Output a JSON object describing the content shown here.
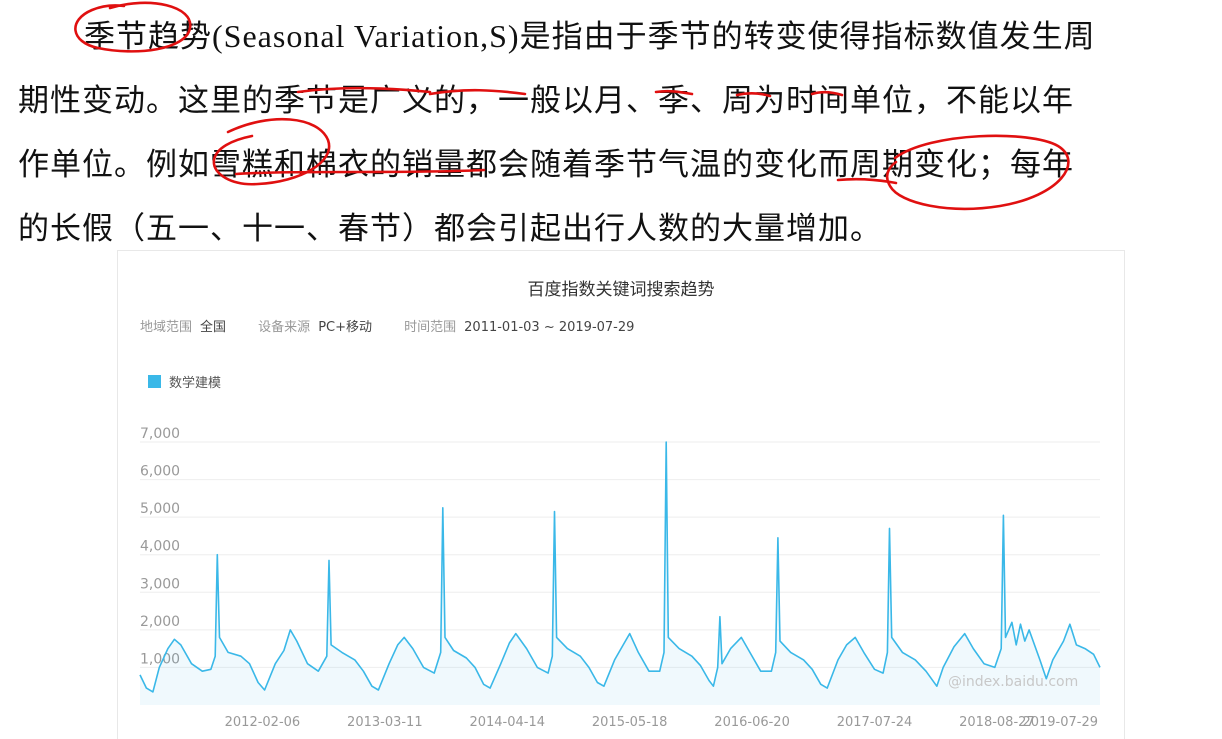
{
  "paragraph": {
    "lines": [
      [
        "季节趋势",
        "(Seasonal Variation,S)",
        "是指由于季节的转变使得指标数值发生周"
      ],
      [
        "期性变动。这里的季节是广义的，一般以月、季、周为时间单位，不能以年"
      ],
      [
        "作单位。例如雪糕和棉衣的销量都会随着季节气温的变化而周期变化；每年"
      ],
      [
        "的长假（五一、十一、春节）都会引起出行人数的大量增加。"
      ]
    ]
  },
  "colors": {
    "series": "#3ab8e8",
    "annotation": "#e01010",
    "grid": "#eeeeee",
    "axis_text": "#999999"
  },
  "card": {
    "title": "百度指数关键词搜索趋势",
    "meta": [
      {
        "key": "地域范围",
        "value": "全国"
      },
      {
        "key": "设备来源",
        "value": "PC+移动"
      },
      {
        "key": "时间范围",
        "value": "2011-01-03 ~ 2019-07-29"
      }
    ],
    "watermark": "@index.baidu.com"
  },
  "chart_data": {
    "type": "area",
    "series": [
      {
        "name": "数学建模"
      }
    ],
    "xlabel": "",
    "ylabel": "",
    "ylim": [
      0,
      7000
    ],
    "yticks": [
      "1,000",
      "2,000",
      "3,000",
      "4,000",
      "5,000",
      "6,000",
      "7,000"
    ],
    "xtick_labels": [
      "2012-02-06",
      "2013-03-11",
      "2014-04-14",
      "2015-05-18",
      "2016-06-20",
      "2017-07-24",
      "2018-08-27",
      "2019-07-29"
    ],
    "grid": true,
    "legend": "top-left",
    "points": [
      [
        "2011-01-03",
        800
      ],
      [
        "2011-01-24",
        450
      ],
      [
        "2011-02-14",
        350
      ],
      [
        "2011-03-07",
        1000
      ],
      [
        "2011-04-04",
        1500
      ],
      [
        "2011-04-25",
        1750
      ],
      [
        "2011-05-16",
        1600
      ],
      [
        "2011-06-20",
        1100
      ],
      [
        "2011-07-25",
        900
      ],
      [
        "2011-08-22",
        950
      ],
      [
        "2011-09-05",
        1300
      ],
      [
        "2011-09-12",
        4000
      ],
      [
        "2011-09-19",
        1800
      ],
      [
        "2011-10-17",
        1400
      ],
      [
        "2011-11-28",
        1300
      ],
      [
        "2011-12-26",
        1100
      ],
      [
        "2012-01-23",
        600
      ],
      [
        "2012-02-13",
        400
      ],
      [
        "2012-03-19",
        1100
      ],
      [
        "2012-04-16",
        1450
      ],
      [
        "2012-05-07",
        2000
      ],
      [
        "2012-05-28",
        1700
      ],
      [
        "2012-07-02",
        1100
      ],
      [
        "2012-08-06",
        900
      ],
      [
        "2012-09-03",
        1300
      ],
      [
        "2012-09-10",
        3850
      ],
      [
        "2012-09-17",
        1600
      ],
      [
        "2012-10-22",
        1400
      ],
      [
        "2012-12-03",
        1200
      ],
      [
        "2012-12-31",
        900
      ],
      [
        "2013-01-28",
        500
      ],
      [
        "2013-02-18",
        400
      ],
      [
        "2013-03-25",
        1100
      ],
      [
        "2013-04-22",
        1600
      ],
      [
        "2013-05-13",
        1800
      ],
      [
        "2013-06-10",
        1500
      ],
      [
        "2013-07-15",
        1000
      ],
      [
        "2013-08-19",
        850
      ],
      [
        "2013-09-09",
        1400
      ],
      [
        "2013-09-16",
        5250
      ],
      [
        "2013-09-23",
        1800
      ],
      [
        "2013-10-21",
        1450
      ],
      [
        "2013-12-02",
        1250
      ],
      [
        "2013-12-30",
        1000
      ],
      [
        "2014-01-27",
        550
      ],
      [
        "2014-02-17",
        450
      ],
      [
        "2014-03-24",
        1100
      ],
      [
        "2014-04-21",
        1650
      ],
      [
        "2014-05-12",
        1900
      ],
      [
        "2014-06-16",
        1500
      ],
      [
        "2014-07-21",
        1000
      ],
      [
        "2014-08-25",
        850
      ],
      [
        "2014-09-08",
        1300
      ],
      [
        "2014-09-15",
        5150
      ],
      [
        "2014-09-22",
        1800
      ],
      [
        "2014-10-27",
        1500
      ],
      [
        "2014-12-08",
        1300
      ],
      [
        "2015-01-05",
        1000
      ],
      [
        "2015-02-02",
        600
      ],
      [
        "2015-02-23",
        500
      ],
      [
        "2015-03-30",
        1200
      ],
      [
        "2015-04-27",
        1600
      ],
      [
        "2015-05-18",
        1900
      ],
      [
        "2015-06-15",
        1400
      ],
      [
        "2015-07-20",
        900
      ],
      [
        "2015-08-24",
        900
      ],
      [
        "2015-09-07",
        1400
      ],
      [
        "2015-09-14",
        7000
      ],
      [
        "2015-09-21",
        1800
      ],
      [
        "2015-10-26",
        1500
      ],
      [
        "2015-12-07",
        1300
      ],
      [
        "2016-01-04",
        1050
      ],
      [
        "2016-02-01",
        650
      ],
      [
        "2016-02-15",
        500
      ],
      [
        "2016-02-29",
        1000
      ],
      [
        "2016-03-07",
        2350
      ],
      [
        "2016-03-14",
        1100
      ],
      [
        "2016-04-11",
        1500
      ],
      [
        "2016-05-16",
        1800
      ],
      [
        "2016-06-13",
        1400
      ],
      [
        "2016-07-18",
        900
      ],
      [
        "2016-08-22",
        900
      ],
      [
        "2016-09-05",
        1400
      ],
      [
        "2016-09-12",
        4450
      ],
      [
        "2016-09-19",
        1700
      ],
      [
        "2016-10-24",
        1400
      ],
      [
        "2016-12-05",
        1200
      ],
      [
        "2017-01-02",
        950
      ],
      [
        "2017-01-30",
        550
      ],
      [
        "2017-02-20",
        450
      ],
      [
        "2017-03-27",
        1200
      ],
      [
        "2017-04-24",
        1600
      ],
      [
        "2017-05-22",
        1800
      ],
      [
        "2017-06-19",
        1400
      ],
      [
        "2017-07-24",
        950
      ],
      [
        "2017-08-21",
        850
      ],
      [
        "2017-09-04",
        1400
      ],
      [
        "2017-09-11",
        4700
      ],
      [
        "2017-09-18",
        1800
      ],
      [
        "2017-10-23",
        1400
      ],
      [
        "2017-12-04",
        1200
      ],
      [
        "2018-01-08",
        900
      ],
      [
        "2018-02-12",
        500
      ],
      [
        "2018-03-05",
        1000
      ],
      [
        "2018-04-09",
        1550
      ],
      [
        "2018-05-14",
        1900
      ],
      [
        "2018-06-11",
        1500
      ],
      [
        "2018-07-16",
        1100
      ],
      [
        "2018-08-20",
        1000
      ],
      [
        "2018-09-10",
        1500
      ],
      [
        "2018-09-17",
        5050
      ],
      [
        "2018-09-24",
        1800
      ],
      [
        "2018-10-15",
        2200
      ],
      [
        "2018-10-29",
        1600
      ],
      [
        "2018-11-12",
        2150
      ],
      [
        "2018-11-26",
        1700
      ],
      [
        "2018-12-10",
        2000
      ],
      [
        "2019-01-14",
        1200
      ],
      [
        "2019-02-04",
        700
      ],
      [
        "2019-02-25",
        1200
      ],
      [
        "2019-04-01",
        1700
      ],
      [
        "2019-04-22",
        2150
      ],
      [
        "2019-05-13",
        1600
      ],
      [
        "2019-06-10",
        1500
      ],
      [
        "2019-07-08",
        1350
      ],
      [
        "2019-07-29",
        1000
      ]
    ]
  }
}
